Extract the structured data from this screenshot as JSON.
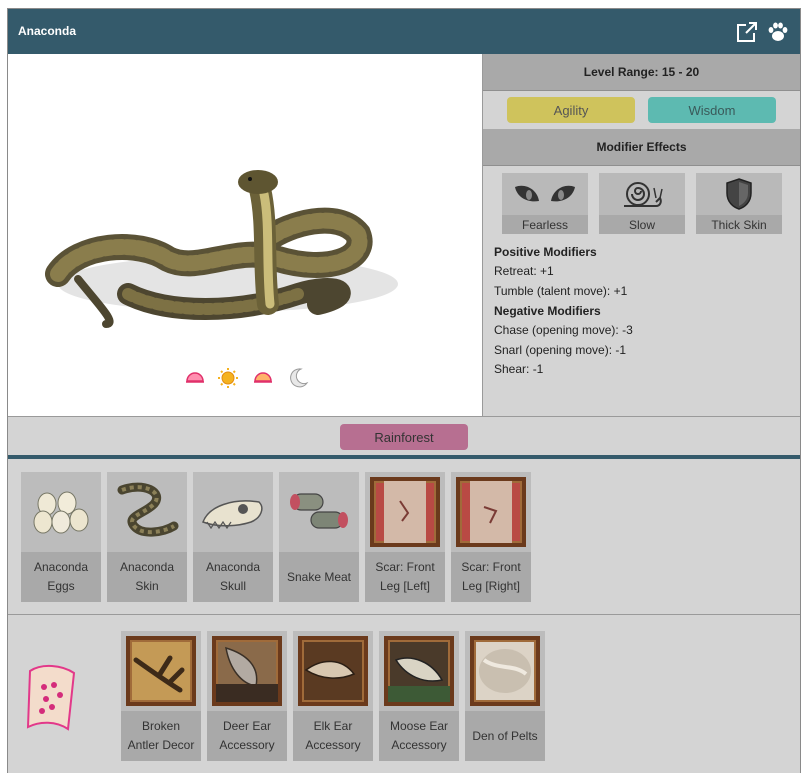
{
  "header": {
    "title": "Anaconda",
    "open_icon": "external-link-icon",
    "paw_icon": "paw-icon"
  },
  "creature": {
    "image": "anaconda-illustration",
    "time_icons": [
      "sunrise-icon",
      "sun-icon",
      "sunset-icon",
      "moon-icon"
    ]
  },
  "info": {
    "level_range": "Level Range: 15 - 20",
    "stats": [
      "Agility",
      "Wisdom"
    ],
    "modifier_title": "Modifier Effects",
    "modifiers": [
      {
        "label": "Fearless",
        "icon": "eyes-icon"
      },
      {
        "label": "Slow",
        "icon": "snail-icon"
      },
      {
        "label": "Thick Skin",
        "icon": "shield-icon"
      }
    ],
    "positive_heading": "Positive Modifiers",
    "positive": [
      "Retreat: +1",
      "Tumble (talent move): +1"
    ],
    "negative_heading": "Negative Modifiers",
    "negative": [
      "Chase (opening move): -3",
      "Snarl (opening move): -1",
      "Shear: -1"
    ]
  },
  "habitat": "Rainforest",
  "drops": [
    {
      "line1": "Anaconda",
      "line2": "Eggs",
      "icon": "eggs-icon"
    },
    {
      "line1": "Anaconda",
      "line2": "Skin",
      "icon": "snake-skin-icon"
    },
    {
      "line1": "Anaconda",
      "line2": "Skull",
      "icon": "skull-icon"
    },
    {
      "line1": "Snake Meat",
      "line2": "",
      "icon": "meat-icon"
    },
    {
      "line1": "Scar: Front",
      "line2": "Leg [Left]",
      "icon": "scar-icon"
    },
    {
      "line1": "Scar: Front",
      "line2": "Leg [Right]",
      "icon": "scar-icon"
    }
  ],
  "rewards": {
    "scroll_icon": "scroll-icon",
    "items": [
      {
        "line1": "Broken",
        "line2": "Antler Decor",
        "icon": "antler-icon"
      },
      {
        "line1": "Deer Ear",
        "line2": "Accessory",
        "icon": "deer-ear-icon"
      },
      {
        "line1": "Elk Ear",
        "line2": "Accessory",
        "icon": "elk-ear-icon"
      },
      {
        "line1": "Moose Ear",
        "line2": "Accessory",
        "icon": "moose-ear-icon"
      },
      {
        "line1": "Den of Pelts",
        "line2": "",
        "icon": "pelt-icon"
      }
    ]
  },
  "colors": {
    "header": "#345a6b",
    "agility": "#cfc35c",
    "wisdom": "#5dbab1",
    "habitat": "#b76f91"
  }
}
